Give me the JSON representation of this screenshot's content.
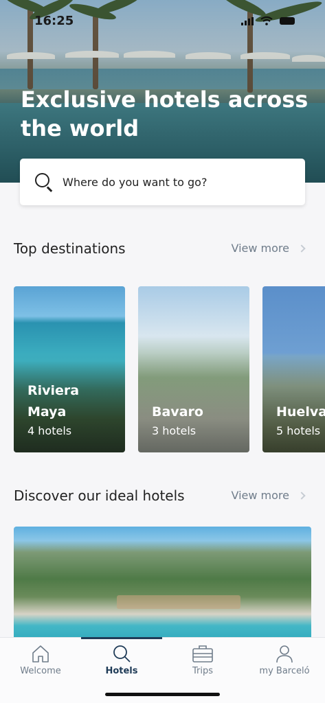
{
  "status_bar": {
    "time": "16:25"
  },
  "hero": {
    "title": "Exclusive hotels across the world"
  },
  "search": {
    "placeholder": "Where do you want to go?"
  },
  "sections": {
    "top_destinations": {
      "title": "Top destinations",
      "view_more": "View more"
    },
    "ideal_hotels": {
      "title": "Discover our ideal hotels",
      "view_more": "View more"
    }
  },
  "destinations": [
    {
      "name": "Riviera Maya",
      "count": "4 hotels"
    },
    {
      "name": "Bavaro",
      "count": "3 hotels"
    },
    {
      "name": "Huelva",
      "count": "5 hotels"
    }
  ],
  "tabs": [
    {
      "label": "Welcome",
      "icon": "home-icon",
      "active": false
    },
    {
      "label": "Hotels",
      "icon": "search-icon",
      "active": true
    },
    {
      "label": "Trips",
      "icon": "suitcase-icon",
      "active": false
    },
    {
      "label": "my Barceló",
      "icon": "user-icon",
      "active": false
    }
  ],
  "colors": {
    "accent": "#1f3b57",
    "muted": "#6f7c8a",
    "background": "#f6f6f8"
  }
}
